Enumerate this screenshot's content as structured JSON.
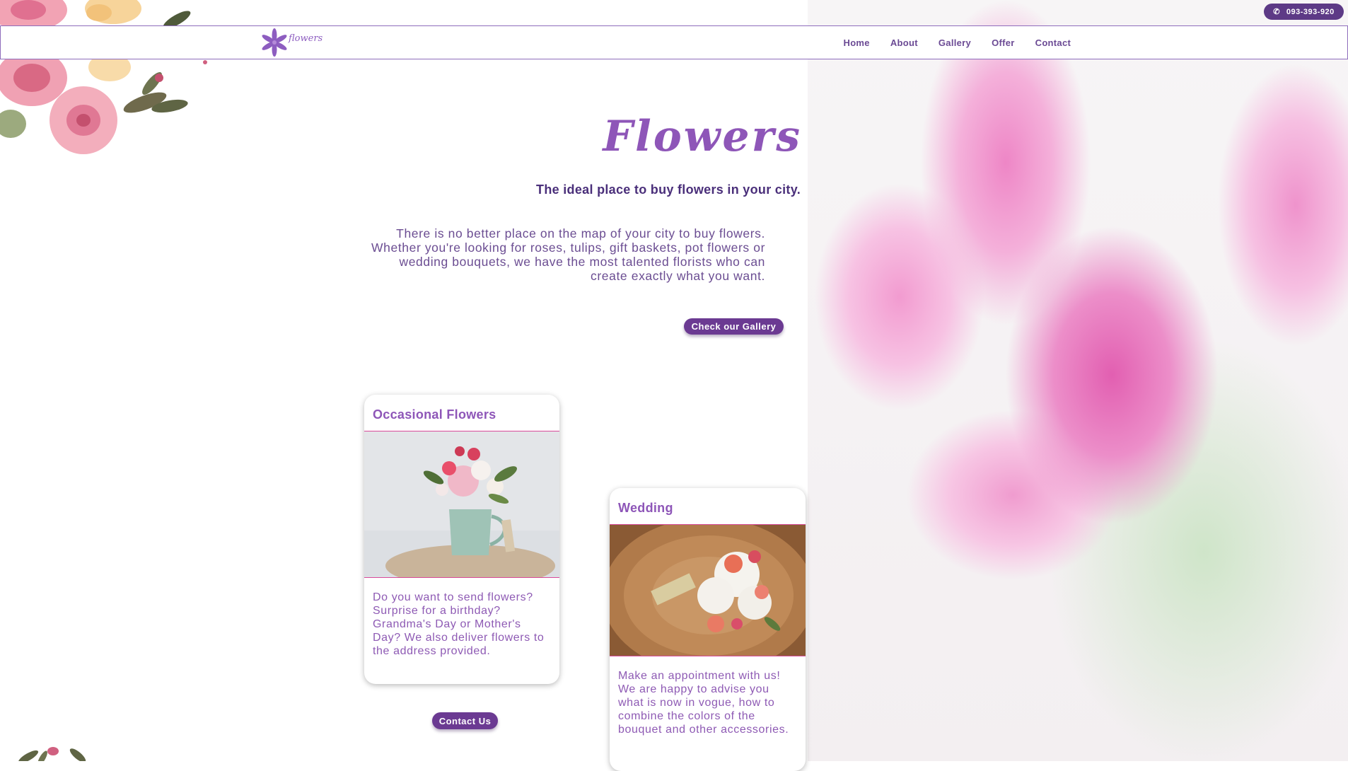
{
  "topbar": {
    "phone": "093-393-920"
  },
  "nav": {
    "logo_text": "flowers",
    "items": [
      {
        "label": "Home"
      },
      {
        "label": "About"
      },
      {
        "label": "Gallery"
      },
      {
        "label": "Offer"
      },
      {
        "label": "Contact"
      }
    ]
  },
  "hero": {
    "title": "Flowers",
    "subtitle": "The ideal place to buy flowers in your city.",
    "text": "There is no better place on the map of your city to buy flowers. Whether you're looking for roses, tulips, gift baskets, pot flowers or wedding bouquets, we have the most talented florists who can create exactly what you want.",
    "cta": "Check our Gallery"
  },
  "cards": [
    {
      "title": "Occasional Flowers",
      "text": "Do you want to send flowers? Surprise for a birthday? Grandma's Day or Mother's Day? We also deliver flowers to the address provided.",
      "image": "flower-jug-photo"
    },
    {
      "title": "Wedding",
      "text": "Make an appointment with us! We are happy to advise you what is now in vogue, how to combine the colors of the bouquet and other accessories.",
      "image": "wedding-bouquet-photo"
    }
  ],
  "contact_button": "Contact Us",
  "colors": {
    "brand_purple": "#6b3a92",
    "title_purple": "#8e56b8",
    "accent_pink": "#d94a9a"
  }
}
